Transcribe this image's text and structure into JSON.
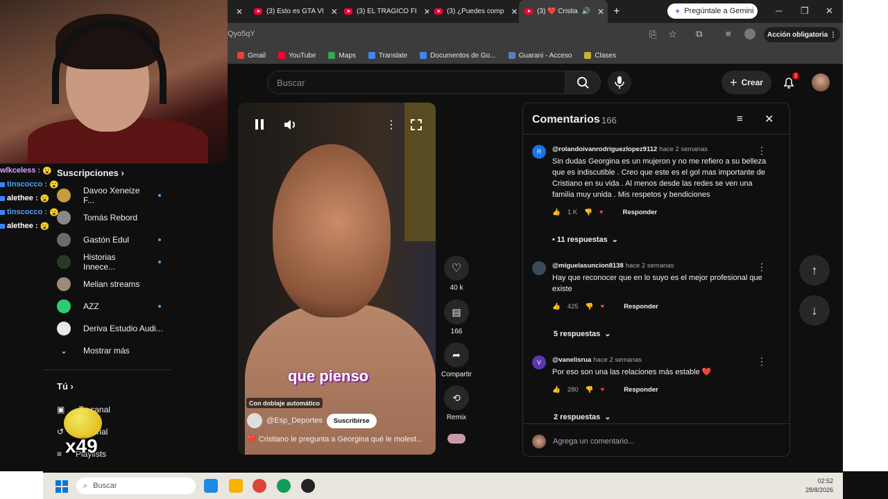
{
  "browser": {
    "tabs": [
      {
        "label": "(3) Esto es GTA VI"
      },
      {
        "label": "(3) EL TRAGICO FI"
      },
      {
        "label": "(3) ¿Puedes comp"
      },
      {
        "label": "(3) ❤️ Cristia"
      }
    ],
    "gemini_label": "Pregúntale a Gemini",
    "url": "Qyo5qY",
    "accion_label": "Acción obligatoria",
    "bookmarks": [
      "Gmail",
      "YouTube",
      "Maps",
      "Translate",
      "Documentos de Go...",
      "Guarani - Acceso",
      "Clases"
    ]
  },
  "header": {
    "search_placeholder": "Buscar",
    "create_label": "Crear",
    "notif_count": "3"
  },
  "chat": [
    {
      "user": "wlkceless :",
      "color": "#d4a5ff"
    },
    {
      "user": "tinscocco :",
      "color": "#4fa3ff"
    },
    {
      "user": "alethee :",
      "color": "#ffffff"
    },
    {
      "user": "tinscocco :",
      "color": "#4fa3ff"
    },
    {
      "user": "alethee :",
      "color": "#ffffff"
    }
  ],
  "sidebar": {
    "heading": "Suscripciones",
    "subs": [
      {
        "label": "Davoo Xeneize F...",
        "color": "#c79a3a",
        "dot": true
      },
      {
        "label": "Tomás Rebord",
        "color": "#888888",
        "dot": false
      },
      {
        "label": "Gastón Edul",
        "color": "#6b6b6b",
        "dot": true
      },
      {
        "label": "Historias Innece...",
        "color": "#2a3a2a",
        "dot": true
      },
      {
        "label": "Melian streams",
        "color": "#9a8a7a",
        "dot": false
      },
      {
        "label": "AZZ",
        "color": "#2ecc71",
        "dot": true
      },
      {
        "label": "Deriva Estudio Audi...",
        "color": "#e8e8e8",
        "dot": false
      }
    ],
    "show_more": "Mostrar más",
    "you": "Tú",
    "you_items": [
      "Tu canal",
      "Historial",
      "Playlists"
    ],
    "overlay_count": "x49"
  },
  "video": {
    "caption": "que pienso",
    "dub_label": "Con doblaje automático",
    "channel": "@Esp_Deportes",
    "subscribe": "Suscribirse",
    "title": "💔 Cristiano le pregunta a Georgina qué le molest..."
  },
  "actions": {
    "likes": "40 k",
    "comments": "166",
    "share": "Compartir",
    "remix": "Remix"
  },
  "comments": {
    "title": "Comentarios",
    "count": "166",
    "items": [
      {
        "avatar": "R",
        "avatar_color": "#1a73e8",
        "user": "@rolandoivanrodriguezlopez9112",
        "time": "hace 2 semanas",
        "text": "Sin dudas Georgina es un mujeron y no me refiero a su belleza que es indiscutible . Creo que este es el gol mas importante de Cristiano en su vida . Al menos desde las redes se ven una familia muy unida . Mis respetos y bendiciones",
        "likes": "1 K",
        "reply": "Responder",
        "replies": "• 11 respuestas"
      },
      {
        "avatar": "",
        "avatar_color": "#3a4a5a",
        "user": "@miguelasuncion8138",
        "time": "hace 2 semanas",
        "text": "Hay que reconocer que  en lo suyo es el mejor profesional que existe",
        "likes": "425",
        "reply": "Responder",
        "replies": "5 respuestas"
      },
      {
        "avatar": "V",
        "avatar_color": "#5e35b1",
        "user": "@vanelisrua",
        "time": "hace 2 semanas",
        "text": "Por eso son una las relaciones más estable ❤️",
        "likes": "280",
        "reply": "Responder",
        "replies": "2 respuestas"
      }
    ],
    "add_placeholder": "Agrega un comentario..."
  },
  "taskbar": {
    "search": "Buscar",
    "time": "02:52",
    "date": "28/8/2026"
  }
}
